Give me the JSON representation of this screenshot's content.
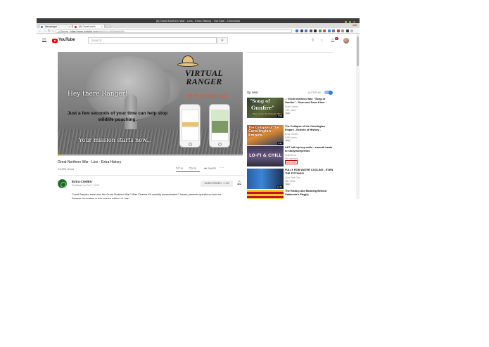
{
  "window": {
    "title": "(8) Great Northern War - Lies - Extra History - YouTube - Chromium",
    "dot_colors": [
      "#e0a22f",
      "#7fbd4a",
      "#d9472b"
    ]
  },
  "tabs": [
    {
      "label": "Messenger",
      "color": "#2b7de9"
    },
    {
      "label": "(8) Great North",
      "color": "#ff0000"
    }
  ],
  "profile_label": "edit",
  "toolbar": {
    "secure_label": "Secure",
    "url_host": "https://www.youtube.com",
    "url_path": "/watch?v=Yd2a4qbA4Pg",
    "extension_colors": [
      "#2b7de9",
      "#4a4a4a",
      "#3c7bd0",
      "#555",
      "#2a2a2a",
      "#3b9e5a",
      "#d44",
      "#4285f4",
      "#777",
      "#cc3333",
      "#999",
      "#3a3a3a",
      "#bbb"
    ]
  },
  "youtube": {
    "logo_text": "YouTube",
    "region": "CA",
    "search_placeholder": "Search",
    "notifications_count": "8"
  },
  "ad": {
    "hey": "Hey there Ranger!",
    "blurb": "Just a few seconds of your time can help stop wildlife poaching.",
    "mission": "Your mission starts now...",
    "brand": "VIRTUAL RANGER",
    "free_download": "FREE DOWNLOAD"
  },
  "video": {
    "progress": 0.02,
    "title": "Great Northern War - Lies - Extra History",
    "views": "13,950 views",
    "likes": "1K",
    "dislikes": "23",
    "share_label": "SHARE",
    "more_label": "···"
  },
  "channel": {
    "name": "Extra Credits",
    "published": "Published on Oct 7, 2017",
    "subscribe_label": "SUBSCRIBED",
    "subscriber_count": "1.1M",
    "description": "Could Sweden have won the Great Northern War? Was Charles XII actually assassinated? James presents questions from our Patreon supporters in this special edition of Lies!"
  },
  "sidebar": {
    "up_next": "Up next",
    "autoplay": "AUTOPLAY",
    "recommendations": [
      {
        "title": "♫ Great Northern War: \"Song of Gunfire\" - Sean and Dean Kiner -",
        "channel": "Extra Credits",
        "views": "7.5K views",
        "badge": "New",
        "duration": "5:00",
        "thumb_line1": "\"Song of",
        "thumb_line2": "Gunfire\"",
        "thumb_line3": "The Great Northern War"
      },
      {
        "title": "The Collapse of the Carolingian Empire - Echoes of History -",
        "channel": "Extra Credits",
        "views": "5,996 views",
        "badge": "New",
        "duration": "3:31",
        "thumb_line1": "The Collapse of the",
        "thumb_line2": "Carolingian",
        "thumb_line3": "Empire"
      },
      {
        "title": "24/7 lofi hip hop radio - smooth beats to study/sleep/relax",
        "channel": "ChilledCow",
        "views": "487 watching",
        "badge": "LIVE NOW",
        "duration": "",
        "thumb_line1": "LO-FI & CHILL",
        "thumb_line2": "",
        "thumb_line3": ""
      },
      {
        "title": "FULLY ROB WATER COOLING - EVEN THE FITTINGS!",
        "channel": "Linus Tech Tips",
        "views": "88K views",
        "badge": "New",
        "duration": "11:52",
        "thumb_line1": "",
        "thumb_line2": "",
        "thumb_line3": ""
      },
      {
        "title": "The History and Meaning Behind Catalonia's Flag(s)",
        "channel": "",
        "views": "",
        "badge": "",
        "duration": "",
        "thumb_line1": "",
        "thumb_line2": "",
        "thumb_line3": ""
      }
    ]
  }
}
